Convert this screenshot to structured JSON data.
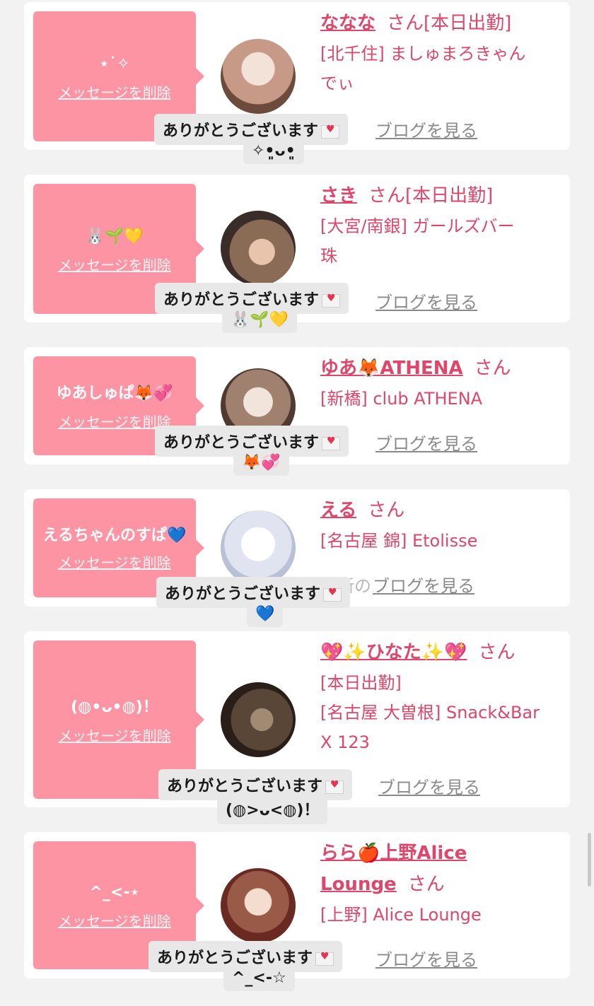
{
  "cards": [
    {
      "bubble_message": "⋆˙✧",
      "delete_label": "メッセージを削除",
      "name": "ななな",
      "san": "さん",
      "badge": "[本日出勤]",
      "shop_lines": [
        "[北千住] ましゅまろきゃん",
        "でぃ"
      ],
      "blog_prefix": "",
      "blog_label": "ブログを見る",
      "thanks_text": "ありがとうございます",
      "thanks_sub": "✧•͈ᴗ•͈",
      "avatar_colors": [
        "#e9d3c7",
        "#c69a86"
      ]
    },
    {
      "bubble_message": "🐰🌱💛",
      "delete_label": "メッセージを削除",
      "name": "さき",
      "san": "さん",
      "badge": "[本日出勤]",
      "shop_lines": [
        "[大宮/南銀] ガールズバー",
        "珠"
      ],
      "blog_prefix": "",
      "blog_label": "ブログを見る",
      "thanks_text": "ありがとうございます",
      "thanks_sub": "🐰🌱💛",
      "avatar_colors": [
        "#8a6b55",
        "#3a2c28"
      ]
    },
    {
      "bubble_message": "ゆあしゅぱ🦊💞",
      "delete_label": "メッセージを削除",
      "name": "ゆあ🦊ATHENA",
      "san": "さん",
      "badge": "",
      "shop_lines": [
        "[新橋] club ATHENA"
      ],
      "blog_prefix": "",
      "blog_label": "ブログを見る",
      "thanks_text": "ありがとうございます",
      "thanks_sub": "🦊💞",
      "avatar_colors": [
        "#e8dcd2",
        "#7b5a4a"
      ]
    },
    {
      "bubble_message": "えるちゃんのすぱ💙",
      "delete_label": "メッセージを削除",
      "name": "える",
      "san": "さん",
      "badge": "",
      "shop_lines": [
        "[名古屋 錦] Etolisse"
      ],
      "blog_prefix": "最新の",
      "blog_label": "ブログを見る",
      "thanks_text": "ありがとうございます",
      "thanks_sub": "💙",
      "avatar_colors": [
        "#f4f6fb",
        "#c8cfe0"
      ]
    },
    {
      "bubble_message": "(◍•ᴗ•◍)！",
      "delete_label": "メッセージを削除",
      "name": "💖✨ひなた✨💖",
      "san": "さん",
      "badge": "[本日出勤]",
      "shop_lines": [
        "[名古屋 大曽根] Snack&Bar",
        "X 123"
      ],
      "blog_prefix": "",
      "blog_label": "ブログを見る",
      "thanks_text": "ありがとうございます",
      "thanks_sub": "(◍>ᴗ<◍)！",
      "avatar_colors": [
        "#3b2c22",
        "#8a7660"
      ]
    },
    {
      "bubble_message": "^_<-⋆",
      "delete_label": "メッセージを削除",
      "name": "らら🍎上野Alice Lounge",
      "san": "さん",
      "badge": "",
      "shop_lines": [
        "[上野] Alice Lounge"
      ],
      "blog_prefix": "",
      "blog_label": "ブログを見る",
      "thanks_text": "ありがとうございます",
      "thanks_sub": "^_<-☆",
      "avatar_colors": [
        "#b84a3a",
        "#f0d4c6"
      ]
    }
  ]
}
